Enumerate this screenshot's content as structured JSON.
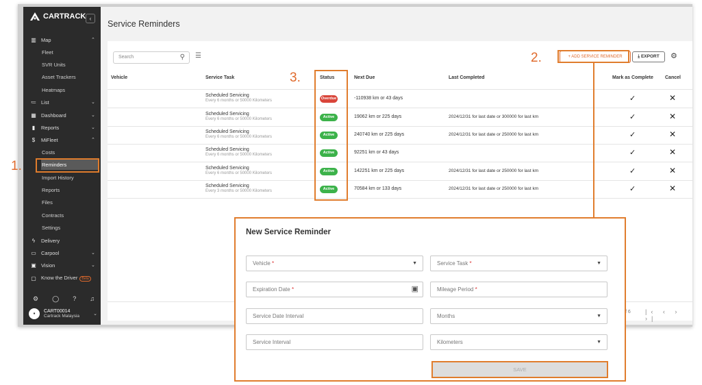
{
  "sidebar": {
    "brand": "CARTRACK",
    "collapse": "‹",
    "nav": [
      {
        "icon": "▥",
        "label": "Map",
        "chev": "⌃"
      },
      {
        "icon": "≔",
        "label": "List",
        "chev": "⌄"
      },
      {
        "icon": "▦",
        "label": "Dashboard",
        "chev": "⌄"
      },
      {
        "icon": "▮",
        "label": "Reports",
        "chev": "⌄"
      },
      {
        "icon": "$",
        "label": "MiFleet",
        "chev": "⌃"
      },
      {
        "icon": "ϟ",
        "label": "Delivery",
        "chev": ""
      },
      {
        "icon": "▭",
        "label": "Carpool",
        "chev": "⌄"
      },
      {
        "icon": "▣",
        "label": "Vision",
        "chev": "⌄"
      },
      {
        "icon": "▢",
        "label": "Know the Driver",
        "chev": ""
      }
    ],
    "map_sub": [
      "Fleet",
      "SVR Units",
      "Asset Trackers",
      "Heatmaps"
    ],
    "mifleet_sub": [
      "Costs",
      "Reminders",
      "Import History",
      "Reports",
      "Files",
      "Contracts",
      "Settings"
    ],
    "beta": "Beta",
    "bottom_icons": [
      "⚙",
      "◯",
      "?",
      "♫"
    ],
    "account": {
      "initial": "▪",
      "name": "CART00014",
      "company": "Cartrack Malaysia",
      "chev": "⌄"
    }
  },
  "main": {
    "title": "Service Reminders",
    "search_placeholder": "Search",
    "add_label": "+ ADD SERVICE REMINDER",
    "export_label": "⤓ EXPORT",
    "columns": [
      "Vehicle",
      "Service Task",
      "Status",
      "Next Due",
      "Last Completed",
      "Mark as Complete",
      "Cancel"
    ],
    "rows": [
      {
        "task": "Scheduled Servicing",
        "interval": "Every 6 months or 50000 Kilometers",
        "status": "Overdue",
        "next_due": "-110938 km or 43 days",
        "last": ""
      },
      {
        "task": "Scheduled Servicing",
        "interval": "Every 6 months or 50000 Kilometers",
        "status": "Active",
        "next_due": "19062 km or 225 days",
        "last": "2024/12/31 for last date or 300000 for last km"
      },
      {
        "task": "Scheduled Servicing",
        "interval": "Every 6 months or 50000 Kilometers",
        "status": "Active",
        "next_due": "240740 km or 225 days",
        "last": "2024/12/31 for last date or 250000 for last km"
      },
      {
        "task": "Scheduled Servicing",
        "interval": "Every 6 months or 50000 Kilometers",
        "status": "Active",
        "next_due": "92251 km or 43 days",
        "last": ""
      },
      {
        "task": "Scheduled Servicing",
        "interval": "Every 6 months or 50000 Kilometers",
        "status": "Active",
        "next_due": "142251 km or 225 days",
        "last": "2024/12/31 for last date or 250000 for last km"
      },
      {
        "task": "Scheduled Servicing",
        "interval": "Every 3 months or 50000 Kilometers",
        "status": "Active",
        "next_due": "70584 km or 133 days",
        "last": "2024/12/31 for last date or 250000 for last km"
      }
    ],
    "pager_text": "f 6",
    "pager_nav": "|‹ ‹ › ›|"
  },
  "modal": {
    "title": "New Service Reminder",
    "vehicle": "Vehicle",
    "service_task": "Service Task",
    "expiration_date": "Expiration Date",
    "mileage_period": "Mileage Period",
    "service_date_interval": "Service Date Interval",
    "months": "Months",
    "service_interval": "Service Interval",
    "kilometers": "Kilometers",
    "save": "SAVE",
    "req": "*"
  },
  "callouts": {
    "one": "1.",
    "two": "2.",
    "three": "3."
  },
  "colors": {
    "accent": "#e07c2c",
    "overdue": "#d9453a",
    "active": "#3cb24a"
  }
}
